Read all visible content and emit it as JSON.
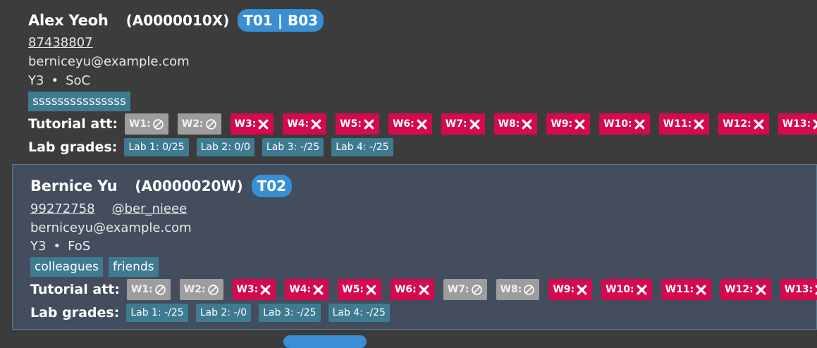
{
  "people": [
    {
      "name": "Alex Yeoh",
      "student_id": "(A0000010X)",
      "group": "T01 | B03",
      "phone": "87438807",
      "telegram": "",
      "email": "berniceyu@example.com",
      "year": "Y3",
      "faculty": "SoC",
      "separator": "•",
      "tags": [
        "sssssssssssssss"
      ],
      "tutorial_label": "Tutorial att:",
      "attendance": [
        {
          "week": "W1:",
          "status": "none"
        },
        {
          "week": "W2:",
          "status": "none"
        },
        {
          "week": "W3:",
          "status": "absent"
        },
        {
          "week": "W4:",
          "status": "absent"
        },
        {
          "week": "W5:",
          "status": "absent"
        },
        {
          "week": "W6:",
          "status": "absent"
        },
        {
          "week": "W7:",
          "status": "absent"
        },
        {
          "week": "W8:",
          "status": "absent"
        },
        {
          "week": "W9:",
          "status": "absent"
        },
        {
          "week": "W10:",
          "status": "absent"
        },
        {
          "week": "W11:",
          "status": "absent"
        },
        {
          "week": "W12:",
          "status": "absent"
        },
        {
          "week": "W13:",
          "status": "absent"
        }
      ],
      "lab_label": "Lab grades:",
      "lab_grades": [
        "Lab 1: 0/25",
        "Lab 2: 0/0",
        "Lab 3: -/25",
        "Lab 4: -/25"
      ]
    },
    {
      "name": "Bernice Yu",
      "student_id": "(A0000020W)",
      "group": "T02",
      "phone": "99272758",
      "telegram": "@ber_nieee",
      "email": "berniceyu@example.com",
      "year": "Y3",
      "faculty": "FoS",
      "separator": "•",
      "tags": [
        "colleagues",
        "friends"
      ],
      "tutorial_label": "Tutorial att:",
      "attendance": [
        {
          "week": "W1:",
          "status": "none"
        },
        {
          "week": "W2:",
          "status": "none"
        },
        {
          "week": "W3:",
          "status": "absent"
        },
        {
          "week": "W4:",
          "status": "absent"
        },
        {
          "week": "W5:",
          "status": "absent"
        },
        {
          "week": "W6:",
          "status": "absent"
        },
        {
          "week": "W7:",
          "status": "none"
        },
        {
          "week": "W8:",
          "status": "none"
        },
        {
          "week": "W9:",
          "status": "absent"
        },
        {
          "week": "W10:",
          "status": "absent"
        },
        {
          "week": "W11:",
          "status": "absent"
        },
        {
          "week": "W12:",
          "status": "absent"
        },
        {
          "week": "W13:",
          "status": "absent"
        }
      ],
      "lab_label": "Lab grades:",
      "lab_grades": [
        "Lab 1: -/25",
        "Lab 2: -/0",
        "Lab 3: -/25",
        "Lab 4: -/25"
      ]
    }
  ],
  "icons": {
    "absent": "close-icon",
    "none": "not-applicable-icon"
  },
  "colors": {
    "absent": "#d5094f",
    "none": "#9d9d9d",
    "tag": "#3e7b91",
    "group_pill": "#3a8fd4",
    "selected_card": "#434d5e",
    "background": "#3c3c3c"
  }
}
